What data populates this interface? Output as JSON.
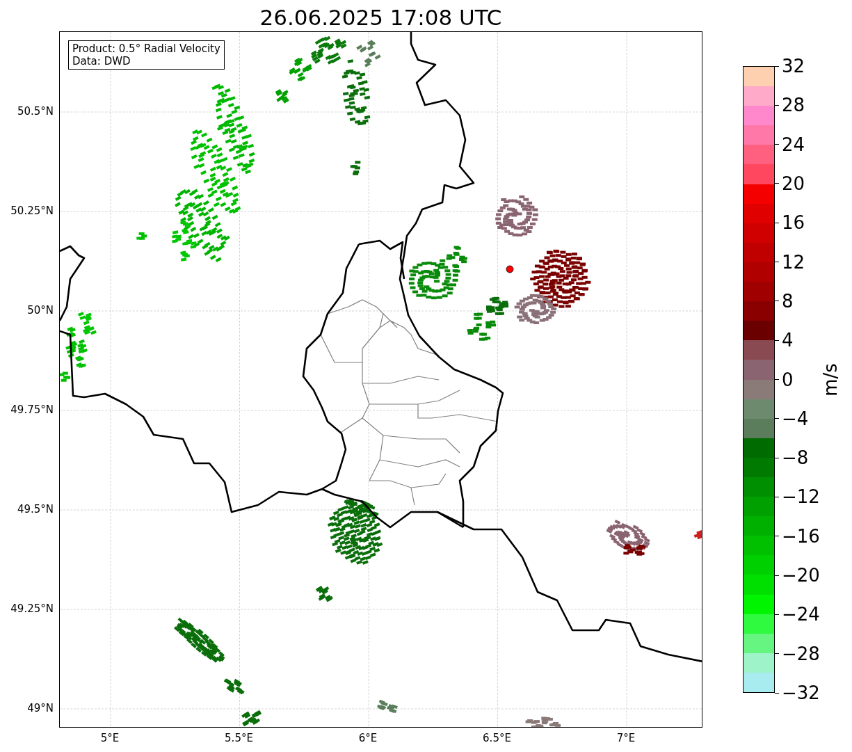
{
  "title": "26.06.2025 17:08 UTC",
  "info_box": {
    "lines": [
      "Product: 0.5° Radial Velocity",
      "Data: DWD"
    ]
  },
  "map": {
    "y_ticks": [
      "50.5°N",
      "50.25°N",
      "50°N",
      "49.75°N",
      "49.5°N",
      "49.25°N",
      "49°N"
    ],
    "x_ticks": [
      "5°E",
      "5.5°E",
      "6°E",
      "6.5°E",
      "7°E"
    ]
  },
  "colorbar": {
    "label": "m/s",
    "ticks": [
      "32",
      "28",
      "24",
      "20",
      "16",
      "12",
      "8",
      "4",
      "0",
      "−4",
      "−8",
      "−12",
      "−16",
      "−20",
      "−24",
      "−28",
      "−32"
    ]
  }
}
